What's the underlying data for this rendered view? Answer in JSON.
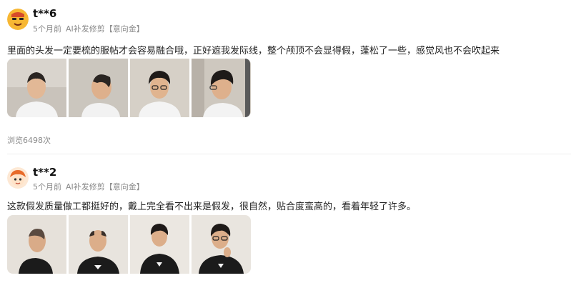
{
  "reviews": [
    {
      "user": "t**6",
      "time": "5个月前",
      "service": "AI补发修剪",
      "tag": "【意向金】",
      "content": "里面的头发一定要梳的服帖才会容易融合哦，正好遮我发际线，整个颅顶不会显得假，蓬松了一些，感觉风也不会吹起来",
      "views": "浏览6498次",
      "photos": [
        "front-view-photo",
        "side-view-photo",
        "front-with-glasses-photo",
        "side-with-glasses-photo"
      ]
    },
    {
      "user": "t**2",
      "time": "5个月前",
      "service": "AI补发修剪",
      "tag": "【意向金】",
      "content": "这款假发质量做工都挺好的，戴上完全看不出来是假发，很自然，贴合度蛮高的，看着年轻了许多。",
      "photos": [
        "side-profile-photo",
        "balding-front-photo",
        "wig-front-photo",
        "wig-glasses-photo"
      ]
    }
  ],
  "colors": {
    "text": "#222222",
    "meta": "#8a8a8a",
    "divider": "#ededed",
    "avatar1": "#f5a623"
  }
}
